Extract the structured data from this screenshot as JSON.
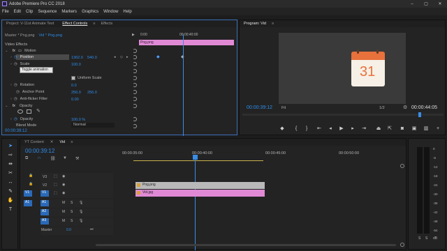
{
  "app": {
    "title": "Adobe Premiere Pro CC 2018"
  },
  "colors": {
    "accent": "#2d8ceb",
    "clip_pink": "#e08ad6",
    "clip_gray": "#b9b9b9",
    "clip_strip": "#d071c8",
    "playhead": "#3a8ce6"
  },
  "menu": [
    "File",
    "Edit",
    "Clip",
    "Sequence",
    "Markers",
    "Graphics",
    "Window",
    "Help"
  ],
  "source_panel": {
    "tabs": [
      "Project: V-11st Animate Text",
      "Effect Controls",
      "Effects"
    ],
    "menu_icon": "≡",
    "master": "Master * Png.png",
    "clip": "Vid * Png.png",
    "ruler_start": "0:00",
    "ruler_mid": "00:00:40:00",
    "clip_bar_label": "Png.png",
    "section": "Video Effects",
    "motion": "Motion",
    "position": {
      "label": "Position",
      "x": "1362.0",
      "y": "540.0"
    },
    "scale": {
      "label": "Scale",
      "value": "100.0"
    },
    "tooltip": "Toggle animation",
    "uniform_scale": "Uniform Scale",
    "rotation": {
      "label": "Rotation",
      "value": "0.0"
    },
    "anchor": {
      "label": "Anchor Point",
      "x": "256.0",
      "y": "256.0"
    },
    "antiflicker": {
      "label": "Anti-flicker Filter",
      "value": "0.00"
    },
    "opacity_section": "Opacity",
    "opacity": {
      "label": "Opacity",
      "value": "100.0 %"
    },
    "blend": {
      "label": "Blend Mode",
      "value": "Normal"
    },
    "timecode": "00:00:39:12"
  },
  "program": {
    "title": "Program: Vid",
    "timecode": "00:00:39:12",
    "fit": "Fit",
    "resolution": "1/2",
    "duration": "00:00:44:05",
    "calendar_day": "31"
  },
  "timeline": {
    "tabs": [
      "YT Content",
      "Vid"
    ],
    "timecode": "00:00:39:12",
    "ruler": [
      "00:00:35:00",
      "00:00:40:00",
      "00:00:45:00",
      "00:00:50:00"
    ],
    "tracks_video": [
      "V3",
      "V2",
      "V1"
    ],
    "tracks_audio": [
      "A1",
      "A2",
      "A3"
    ],
    "src_v": "V1",
    "src_a": "A1",
    "master": "Master",
    "master_value": "0.0",
    "clip_v2": "Png.png",
    "clip_v1": "Vid.jpg",
    "meter_labels": [
      "0",
      "-6",
      "-12",
      "-18",
      "-24",
      "-30",
      "-36",
      "-42",
      "-48",
      "-54"
    ],
    "meter_s": "S",
    "meter_db": "dB"
  }
}
